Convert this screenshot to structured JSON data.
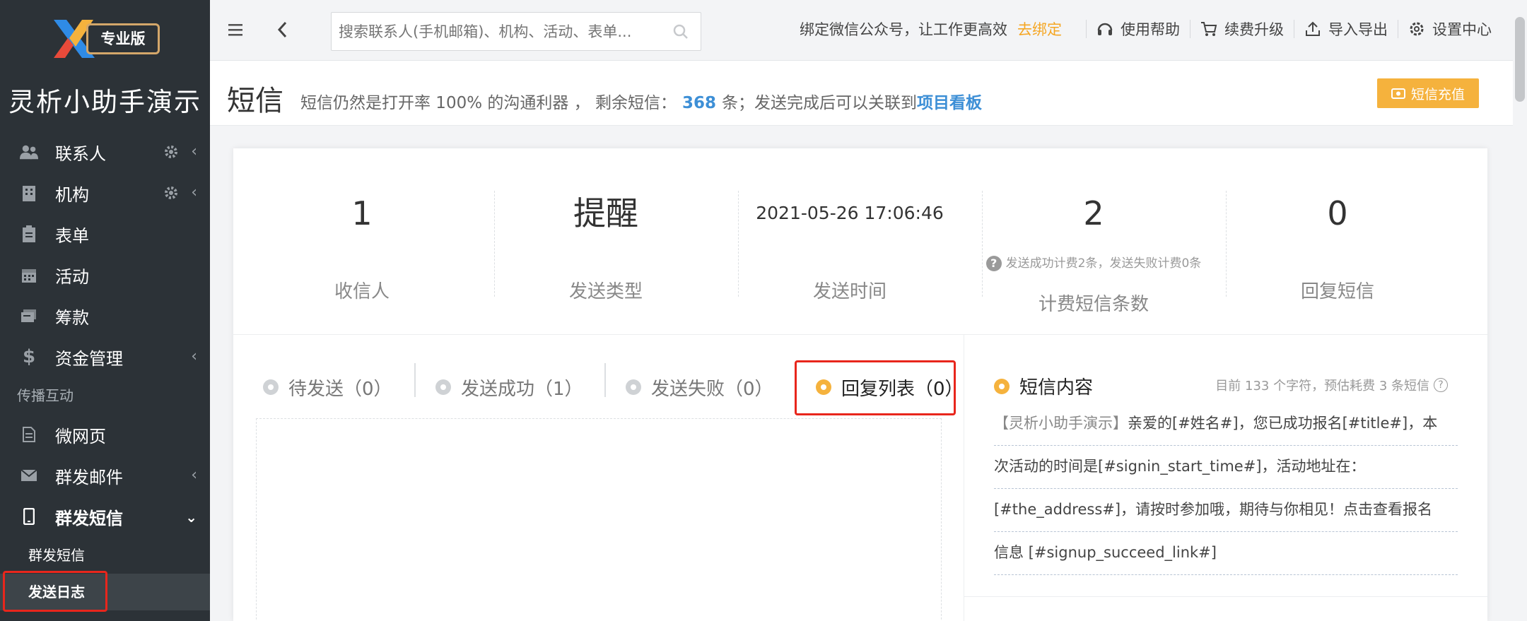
{
  "sidebar": {
    "edition_badge": "专业版",
    "app_title": "灵析小助手演示",
    "items": [
      {
        "label": "联系人",
        "icon": "contacts-icon"
      },
      {
        "label": "机构",
        "icon": "building-icon"
      },
      {
        "label": "表单",
        "icon": "form-icon"
      },
      {
        "label": "活动",
        "icon": "calendar-icon"
      },
      {
        "label": "筹款",
        "icon": "donation-icon"
      },
      {
        "label": "资金管理",
        "icon": "dollar-icon"
      }
    ],
    "section_label": "传播互动",
    "items2": [
      {
        "label": "微网页",
        "icon": "page-icon"
      },
      {
        "label": "群发邮件",
        "icon": "mail-icon"
      },
      {
        "label": "群发短信",
        "icon": "phone-icon"
      }
    ],
    "sub_items": [
      {
        "label": "群发短信"
      },
      {
        "label": "发送日志"
      }
    ]
  },
  "topbar": {
    "search_placeholder": "搜索联系人(手机邮箱)、机构、活动、表单...",
    "wechat_text": "绑定微信公众号，让工作更高效",
    "bind_link": "去绑定",
    "help": "使用帮助",
    "upgrade": "续费升级",
    "import_export": "导入导出",
    "settings": "设置中心"
  },
  "header": {
    "title": "短信",
    "desc_prefix": "短信仍然是打开率 100% 的沟通利器 ， 剩余短信：",
    "remaining": "368",
    "desc_suffix": "条；发送完成后可以关联到",
    "link": "项目看板",
    "recharge": "短信充值"
  },
  "stats": [
    {
      "value": "1",
      "label": "收信人"
    },
    {
      "value": "提醒",
      "label": "发送类型"
    },
    {
      "value": "2021-05-26 17:06:46",
      "label": "发送时间"
    },
    {
      "value": "2",
      "label": "计费短信条数",
      "note": "发送成功计费2条，发送失败计费0条"
    },
    {
      "value": "0",
      "label": "回复短信"
    }
  ],
  "tabs": [
    {
      "label": "待发送（0）",
      "active": false
    },
    {
      "label": "发送成功（1）",
      "active": false
    },
    {
      "label": "发送失败（0）",
      "active": false
    },
    {
      "label": "回复列表（0）",
      "active": true
    }
  ],
  "sms": {
    "heading": "短信内容",
    "meta": "目前 133 个字符，预估耗费 3 条短信",
    "brand": "【灵析小助手演示】",
    "lines": [
      "亲爱的[#姓名#]，您已成功报名[#title#]，本",
      "次活动的时间是[#signin_start_time#]，活动地址在：",
      "[#the_address#]，请按时参加哦，期待与你相见！点击查看报名",
      "信息 [#signup_succeed_link#]"
    ]
  },
  "colors": {
    "sidebar_bg": "#2c3237",
    "accent": "#f5b23d",
    "link_blue": "#3d8fd6",
    "highlight_red": "#e8261c"
  }
}
